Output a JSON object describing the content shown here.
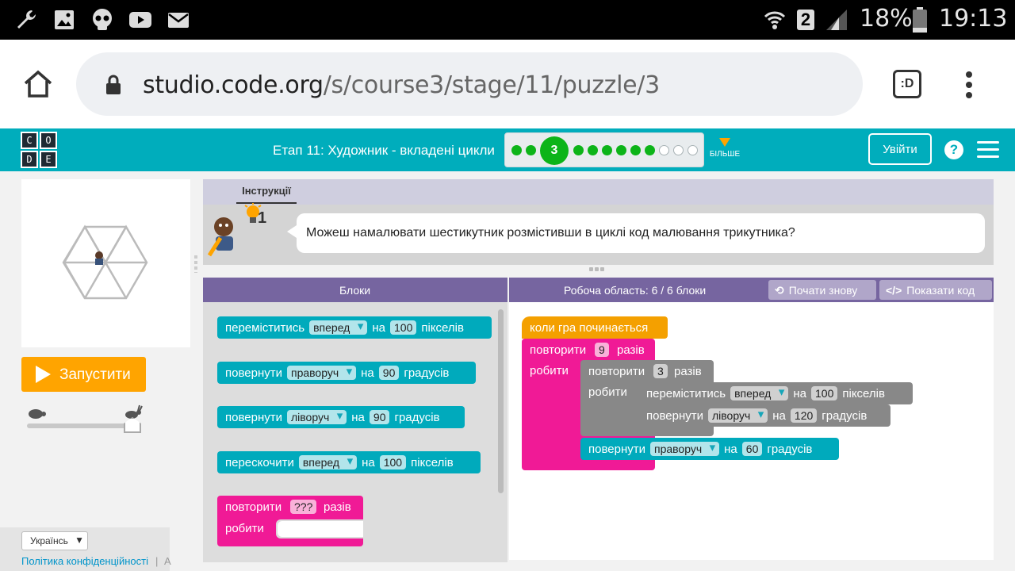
{
  "status_bar": {
    "battery": "18%",
    "network_badge": "2",
    "time": "19:13",
    "icons": [
      "wrench-icon",
      "image-icon",
      "skull-icon",
      "youtube-icon",
      "mail-icon",
      "wifi-icon",
      "signal-icon",
      "battery-icon"
    ]
  },
  "browser": {
    "url_domain": "studio.code.org",
    "url_path": "/s/course3/stage/11/puzzle/3",
    "icons": [
      "home-icon",
      "lock-icon",
      "tab-switcher-icon",
      "more-vert-icon"
    ],
    "tab_label": ":D"
  },
  "header": {
    "logo_letters": [
      "C",
      "O",
      "D",
      "E"
    ],
    "stage_title": "Етап 11: Художник - вкладені цикли",
    "current_level": "3",
    "more_label": "БІЛЬШЕ",
    "signin_label": "Увійти",
    "help_label": "?",
    "colors": {
      "bar": "#00adbc",
      "done": "#0cb418",
      "accent": "#ffa400"
    }
  },
  "run_button": {
    "label": "Запустити"
  },
  "language": {
    "selected": "Українсь"
  },
  "footer": {
    "privacy": "Політика конфіденційності",
    "sep": "|",
    "clipped": "A"
  },
  "instructions": {
    "tab_label": "Інструкції",
    "hint_count": "1",
    "text": "Можеш намалювати шестикутник розмістивши в циклі код малювання трикутника?"
  },
  "toolbox": {
    "header": "Блоки",
    "blocks": [
      {
        "pre": "переміститись",
        "dd": "вперед",
        "mid": "на",
        "num": "100",
        "post": "пікселів"
      },
      {
        "pre": "повернути",
        "dd": "праворуч",
        "mid": "на",
        "num": "90",
        "post": "градусів"
      },
      {
        "pre": "повернути",
        "dd": "ліворуч",
        "mid": "на",
        "num": "90",
        "post": "градусів"
      },
      {
        "pre": "перескочити",
        "dd": "вперед",
        "mid": "на",
        "num": "100",
        "post": "пікселів"
      }
    ],
    "repeat": {
      "pre": "повторити",
      "num": "???",
      "post": "разів",
      "do": "робити"
    }
  },
  "workspace": {
    "header": "Робоча область: 6 / 6 блоки",
    "restart_label": "Почати знову",
    "show_code_label": "Показати код",
    "when_run": "коли гра починається",
    "outer_repeat": {
      "pre": "повторити",
      "num": "9",
      "post": "разів",
      "do": "робити"
    },
    "inner_repeat": {
      "pre": "повторити",
      "num": "3",
      "post": "разів",
      "do": "робити"
    },
    "inner_move": {
      "pre": "переміститись",
      "dd": "вперед",
      "mid": "на",
      "num": "100",
      "post": "пікселів"
    },
    "inner_turn": {
      "pre": "повернути",
      "dd": "ліворуч",
      "mid": "на",
      "num": "120",
      "post": "градусів"
    },
    "outer_turn": {
      "pre": "повернути",
      "dd": "праворуч",
      "mid": "на",
      "num": "60",
      "post": "градусів"
    }
  }
}
